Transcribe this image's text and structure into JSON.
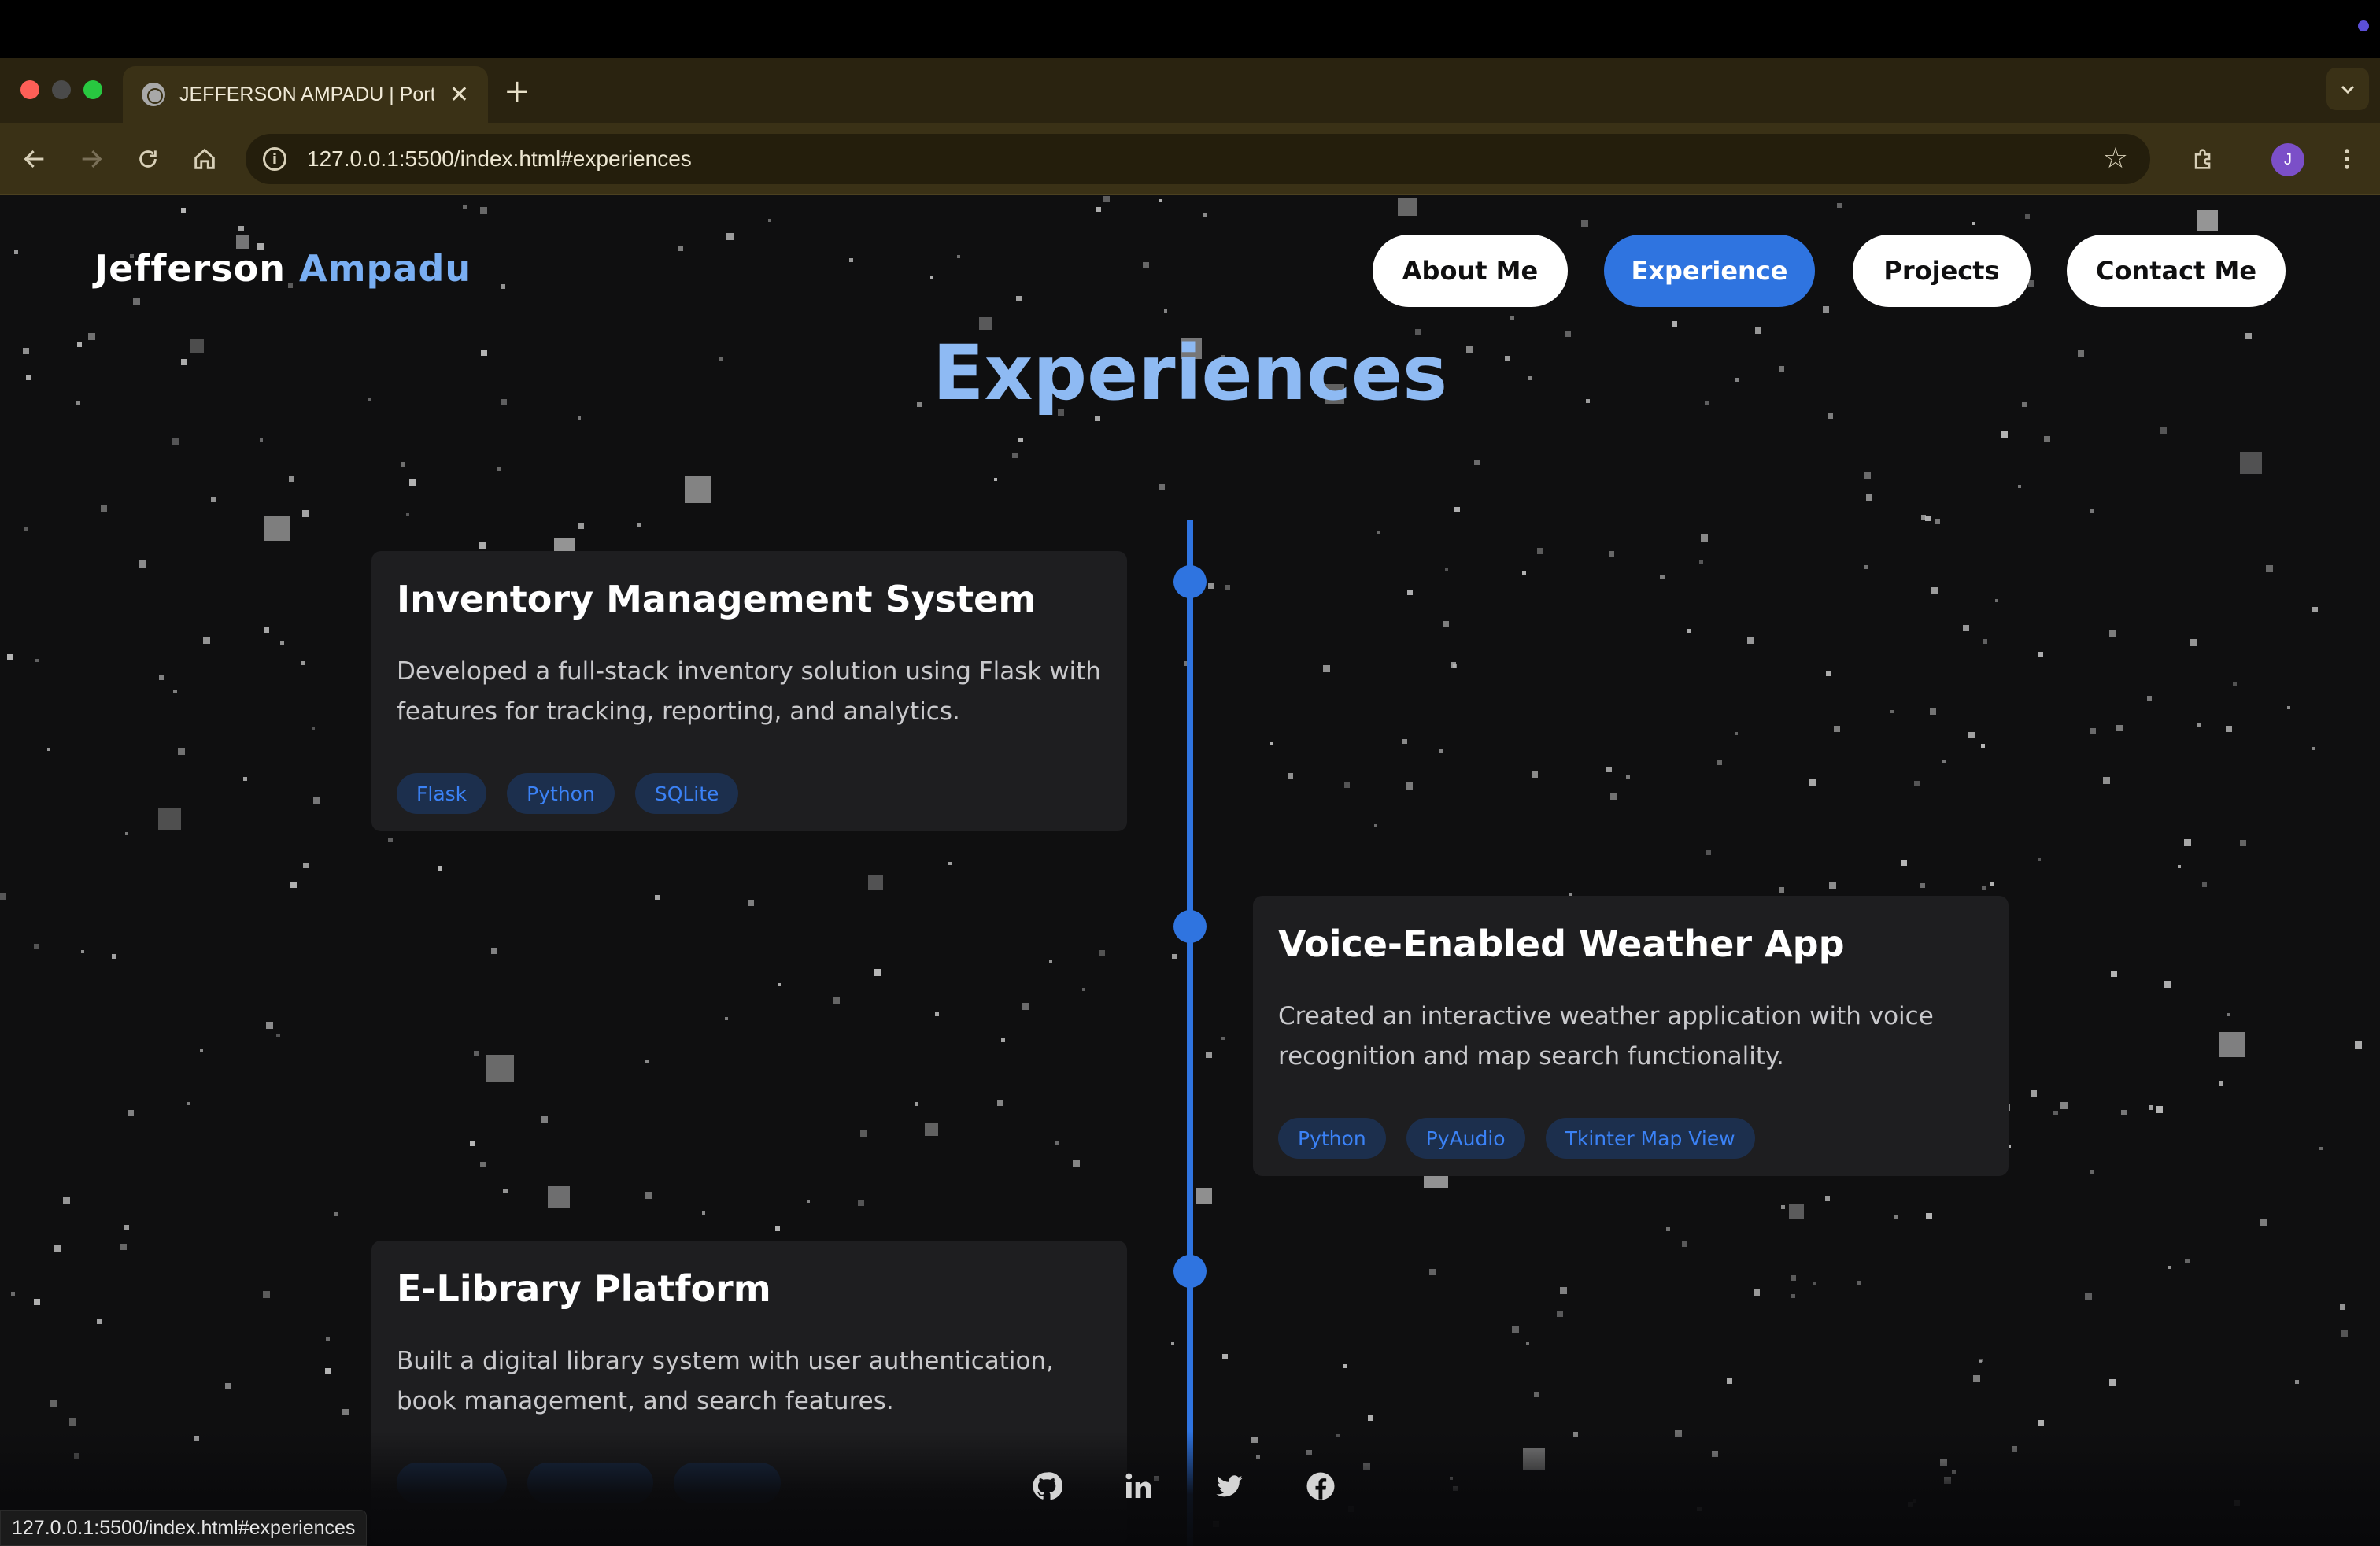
{
  "browser": {
    "tab_title": "JEFFERSON AMPADU | Portfolio",
    "new_tab_glyph": "+",
    "close_glyph": "✕",
    "url": "127.0.0.1:5500/index.html#experiences",
    "profile_initial": "J",
    "status_url": "127.0.0.1:5500/index.html#experiences"
  },
  "header": {
    "brand_first": "Jefferson",
    "brand_last": "Ampadu",
    "nav": [
      {
        "label": "About Me",
        "active": false
      },
      {
        "label": "Experience",
        "active": true
      },
      {
        "label": "Projects",
        "active": false
      },
      {
        "label": "Contact Me",
        "active": false
      }
    ]
  },
  "experiences": {
    "title": "Experiences",
    "items": [
      {
        "title": "Inventory Management System",
        "description": "Developed a full-stack inventory solution using Flask with features for tracking, reporting, and analytics.",
        "tags": [
          "Flask",
          "Python",
          "SQLite"
        ]
      },
      {
        "title": "Voice-Enabled Weather App",
        "description": "Created an interactive weather application with voice recognition and map search functionality.",
        "tags": [
          "Python",
          "PyAudio",
          "Tkinter Map View"
        ]
      },
      {
        "title": "E-Library Platform",
        "description": "Built a digital library system with user authentication, book management, and search features.",
        "tags": [
          "",
          "",
          ""
        ]
      }
    ]
  },
  "footer": {
    "socials": [
      "github-icon",
      "linkedin-icon",
      "twitter-icon",
      "facebook-icon"
    ]
  },
  "colors": {
    "accent": "#2f74e0",
    "brand_accent": "#79aef2",
    "title": "#8ebaf3",
    "background": "#0f0f10",
    "card": "#1e1e20",
    "tag_bg": "#1c2f4d",
    "tag_text": "#3b82f6"
  }
}
